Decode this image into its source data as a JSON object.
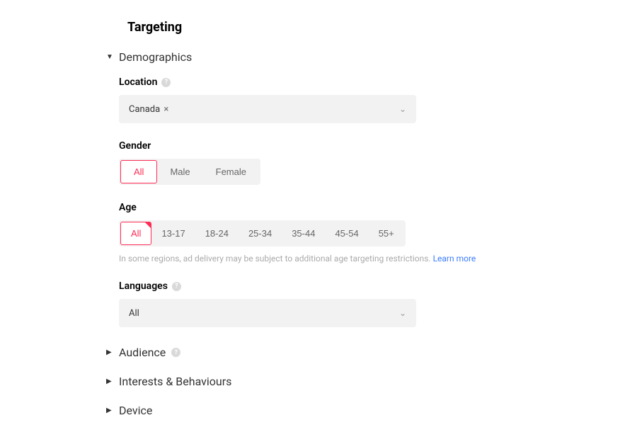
{
  "page": {
    "title": "Targeting"
  },
  "sections": {
    "demographics": {
      "title": "Demographics",
      "expanded": true,
      "location": {
        "label": "Location",
        "value": "Canada"
      },
      "gender": {
        "label": "Gender",
        "options": [
          "All",
          "Male",
          "Female"
        ],
        "selected": "All"
      },
      "age": {
        "label": "Age",
        "options": [
          "All",
          "13-17",
          "18-24",
          "25-34",
          "35-44",
          "45-54",
          "55+"
        ],
        "selected": "All",
        "hint": "In some regions, ad delivery may be subject to additional age targeting restrictions.",
        "learn_more": "Learn more"
      },
      "languages": {
        "label": "Languages",
        "value": "All"
      }
    },
    "audience": {
      "title": "Audience"
    },
    "interests": {
      "title": "Interests & Behaviours"
    },
    "device": {
      "title": "Device"
    }
  }
}
